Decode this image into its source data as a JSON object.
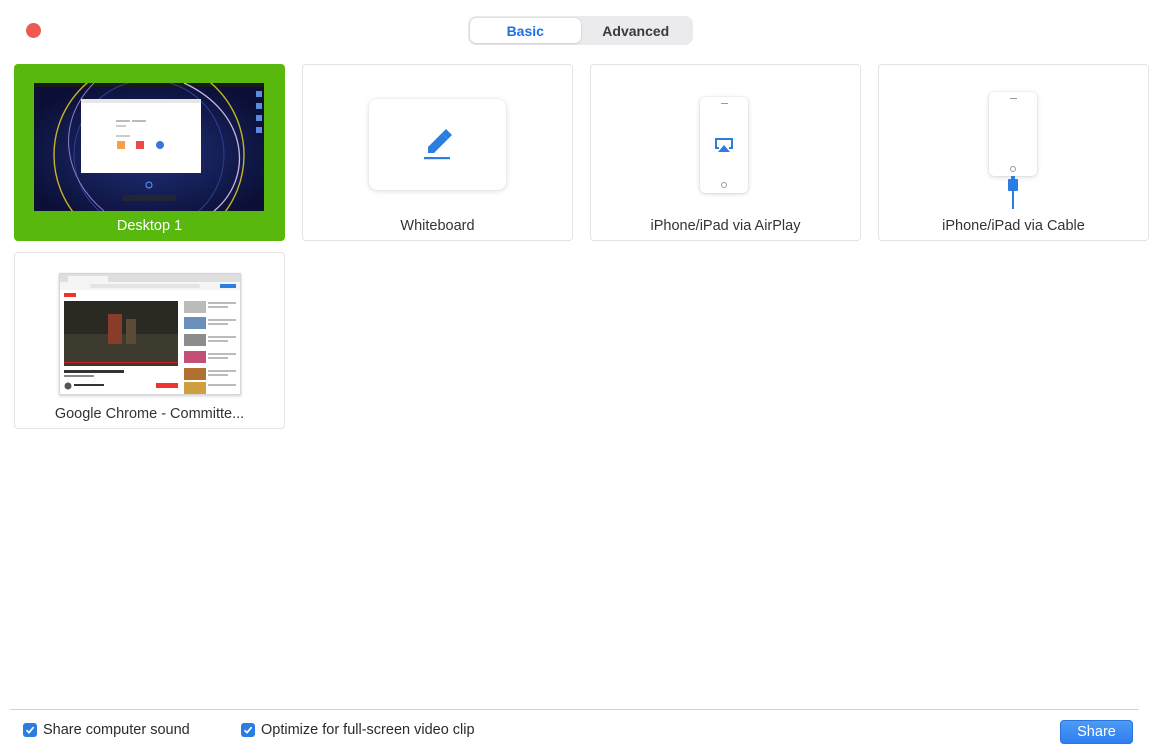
{
  "tabs": [
    {
      "label": "Basic",
      "active": true
    },
    {
      "label": "Advanced",
      "active": false
    }
  ],
  "tiles": [
    {
      "label": "Desktop 1",
      "selected": true
    },
    {
      "label": "Whiteboard",
      "selected": false
    },
    {
      "label": "iPhone/iPad via AirPlay",
      "selected": false
    },
    {
      "label": "iPhone/iPad via Cable",
      "selected": false
    },
    {
      "label": "Google Chrome - Committe...",
      "selected": false
    }
  ],
  "options": {
    "share_sound": {
      "label": "Share computer sound",
      "checked": true
    },
    "optimize_video": {
      "label": "Optimize for full-screen video clip",
      "checked": true
    }
  },
  "share_label": "Share",
  "colors": {
    "selected_tile": "#58b80d",
    "accent": "#1d6fe6",
    "close": "#ee5a52",
    "checkbox": "#2a7de1"
  }
}
